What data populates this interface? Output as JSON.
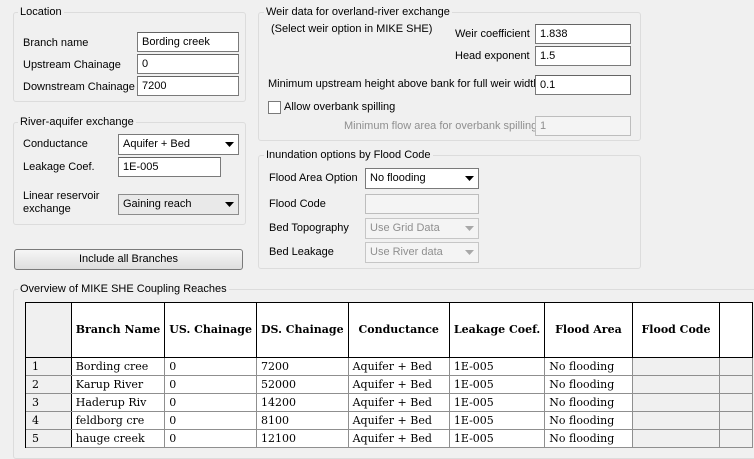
{
  "location": {
    "title": "Location",
    "branch_name_label": "Branch name",
    "branch_name_value": "Bording creek",
    "upstream_label": "Upstream Chainage",
    "upstream_value": "0",
    "downstream_label": "Downstream Chainage",
    "downstream_value": "7200"
  },
  "river_aquifer": {
    "title": "River-aquifer exchange",
    "conductance_label": "Conductance",
    "conductance_value": "Aquifer + Bed",
    "leakage_label": "Leakage Coef.",
    "leakage_value": "1E-005",
    "linear_reservoir_label": "Linear reservoir exchange",
    "linear_reservoir_value": "Gaining reach"
  },
  "include_all_button": "Include all Branches",
  "weir": {
    "title": "Weir data for overland-river exchange",
    "subtitle": "(Select weir option in MIKE SHE)",
    "coef_label": "Weir coefficient",
    "coef_value": "1.838",
    "exponent_label": "Head exponent",
    "exponent_value": "1.5",
    "min_height_label": "Minimum upstream height above bank for full weir width",
    "min_height_value": "0.1",
    "allow_overbank_label": "Allow overbank spilling",
    "allow_overbank_checked": false,
    "min_flow_label": "Minimum flow area for overbank spilling",
    "min_flow_value": "1"
  },
  "inundation": {
    "title": "Inundation options by Flood Code",
    "flood_area_label": "Flood Area Option",
    "flood_area_value": "No flooding",
    "flood_code_label": "Flood Code",
    "flood_code_value": "",
    "bed_topo_label": "Bed Topography",
    "bed_topo_value": "Use Grid Data",
    "bed_leakage_label": "Bed Leakage",
    "bed_leakage_value": "Use River data"
  },
  "overview": {
    "title": "Overview of MIKE SHE Coupling Reaches",
    "columns": [
      "Branch Name",
      "US. Chainage",
      "DS. Chainage",
      "Conductance",
      "Leakage Coef.",
      "Flood Area",
      "Flood Code"
    ],
    "rows": [
      {
        "num": "1",
        "cells": [
          "Bording cree",
          "0",
          "7200",
          "Aquifer + Bed",
          "1E-005",
          "No flooding",
          ""
        ]
      },
      {
        "num": "2",
        "cells": [
          "Karup River",
          "0",
          "52000",
          "Aquifer + Bed",
          "1E-005",
          "No flooding",
          ""
        ]
      },
      {
        "num": "3",
        "cells": [
          "Haderup Riv",
          "0",
          "14200",
          "Aquifer + Bed",
          "1E-005",
          "No flooding",
          ""
        ]
      },
      {
        "num": "4",
        "cells": [
          "feldborg cre",
          "0",
          "8100",
          "Aquifer + Bed",
          "1E-005",
          "No flooding",
          ""
        ]
      },
      {
        "num": "5",
        "cells": [
          "hauge creek",
          "0",
          "12100",
          "Aquifer + Bed",
          "1E-005",
          "No flooding",
          ""
        ]
      }
    ]
  },
  "icons": {
    "dropdown": "chevron-down-icon",
    "dropdown_disabled": "chevron-down-icon"
  }
}
